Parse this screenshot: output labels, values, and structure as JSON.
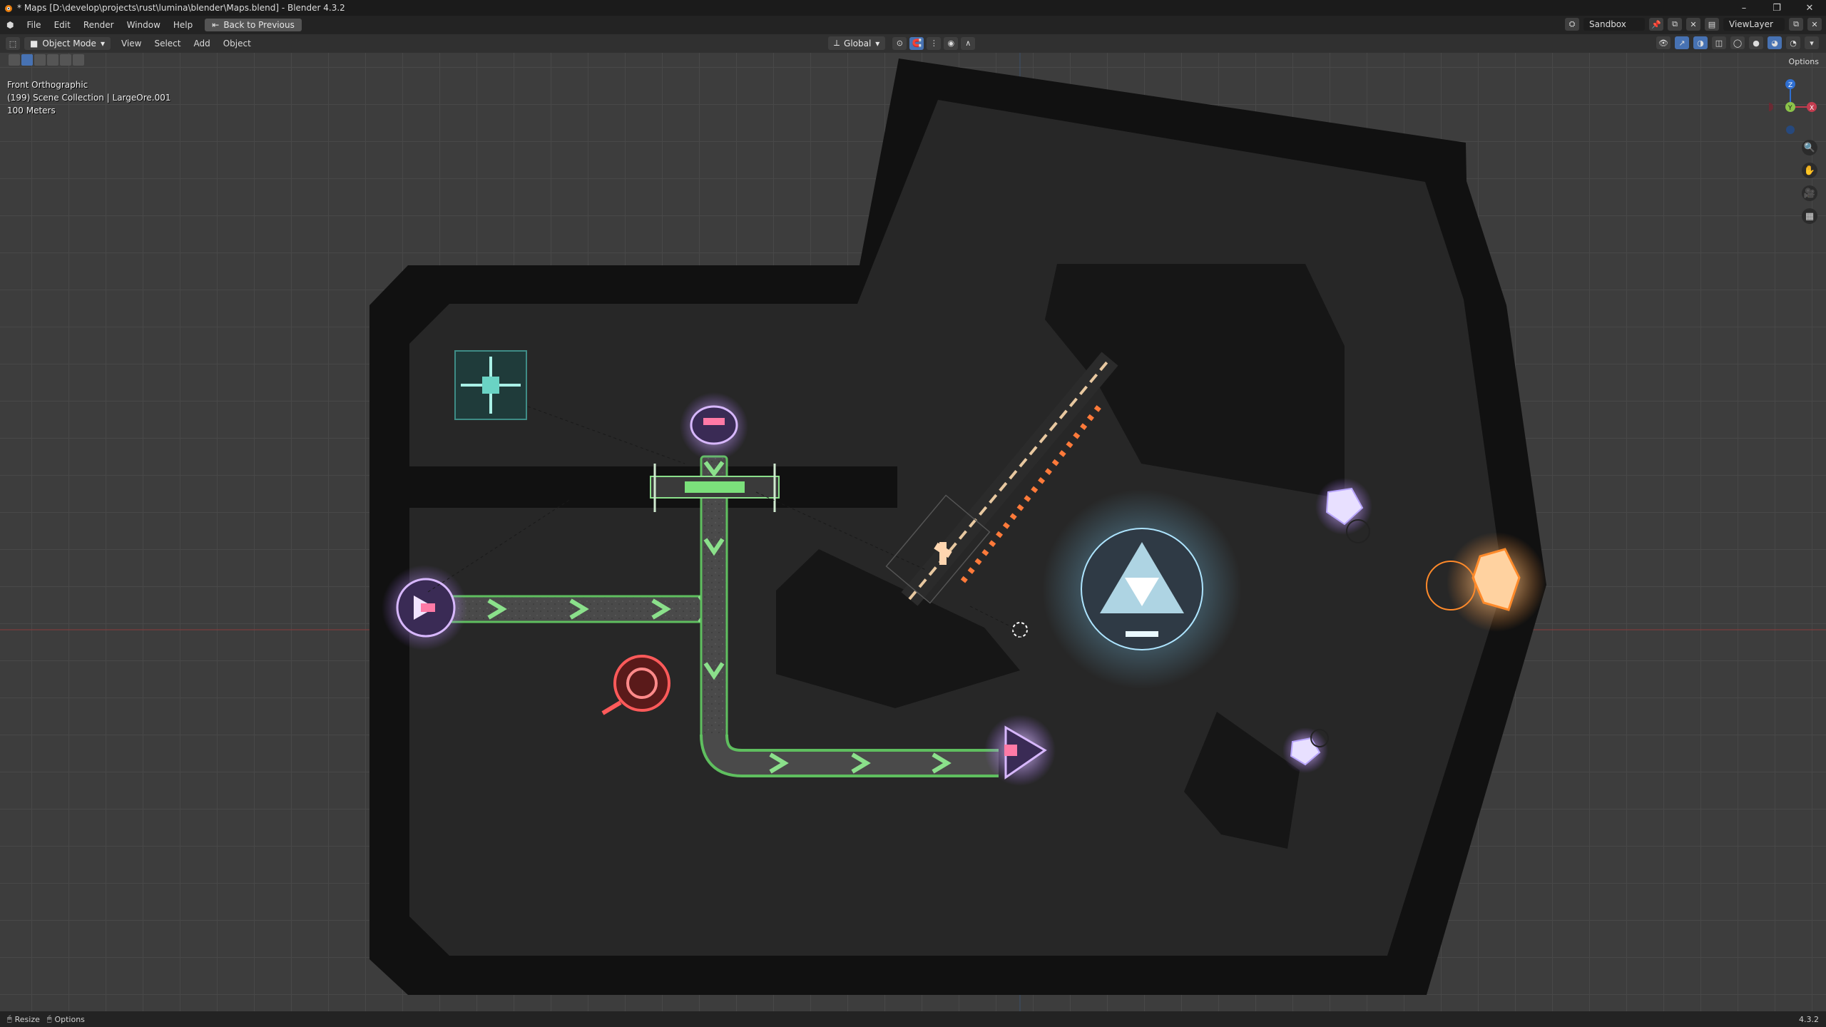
{
  "window": {
    "title": "* Maps [D:\\develop\\projects\\rust\\lumina\\blender\\Maps.blend] - Blender 4.3.2",
    "buttons": [
      "–",
      "❐",
      "✕"
    ]
  },
  "menubar": {
    "items": [
      "File",
      "Edit",
      "Render",
      "Window",
      "Help"
    ],
    "back_button": "Back to Previous",
    "scene": "Sandbox",
    "view_layer": "ViewLayer"
  },
  "viewport_header": {
    "mode": "Object Mode",
    "menus": [
      "View",
      "Select",
      "Add",
      "Object"
    ],
    "orientation": "Global",
    "options_label": "Options"
  },
  "overlay": {
    "view_name": "Front Orthographic",
    "collection": "(199) Scene Collection | LargeOre.001",
    "scale": "100 Meters"
  },
  "gizmo": {
    "z": "Z",
    "y": "Y",
    "x": "X"
  },
  "status": {
    "left1": "Resize",
    "left2": "Options",
    "version": "4.3.2"
  },
  "colors": {
    "accent": "#4772b3",
    "belt_green": "#7be07b",
    "purple_glow": "#b98cff",
    "ore_orange": "#ff9a3c",
    "red_unit": "#d33a3a"
  }
}
